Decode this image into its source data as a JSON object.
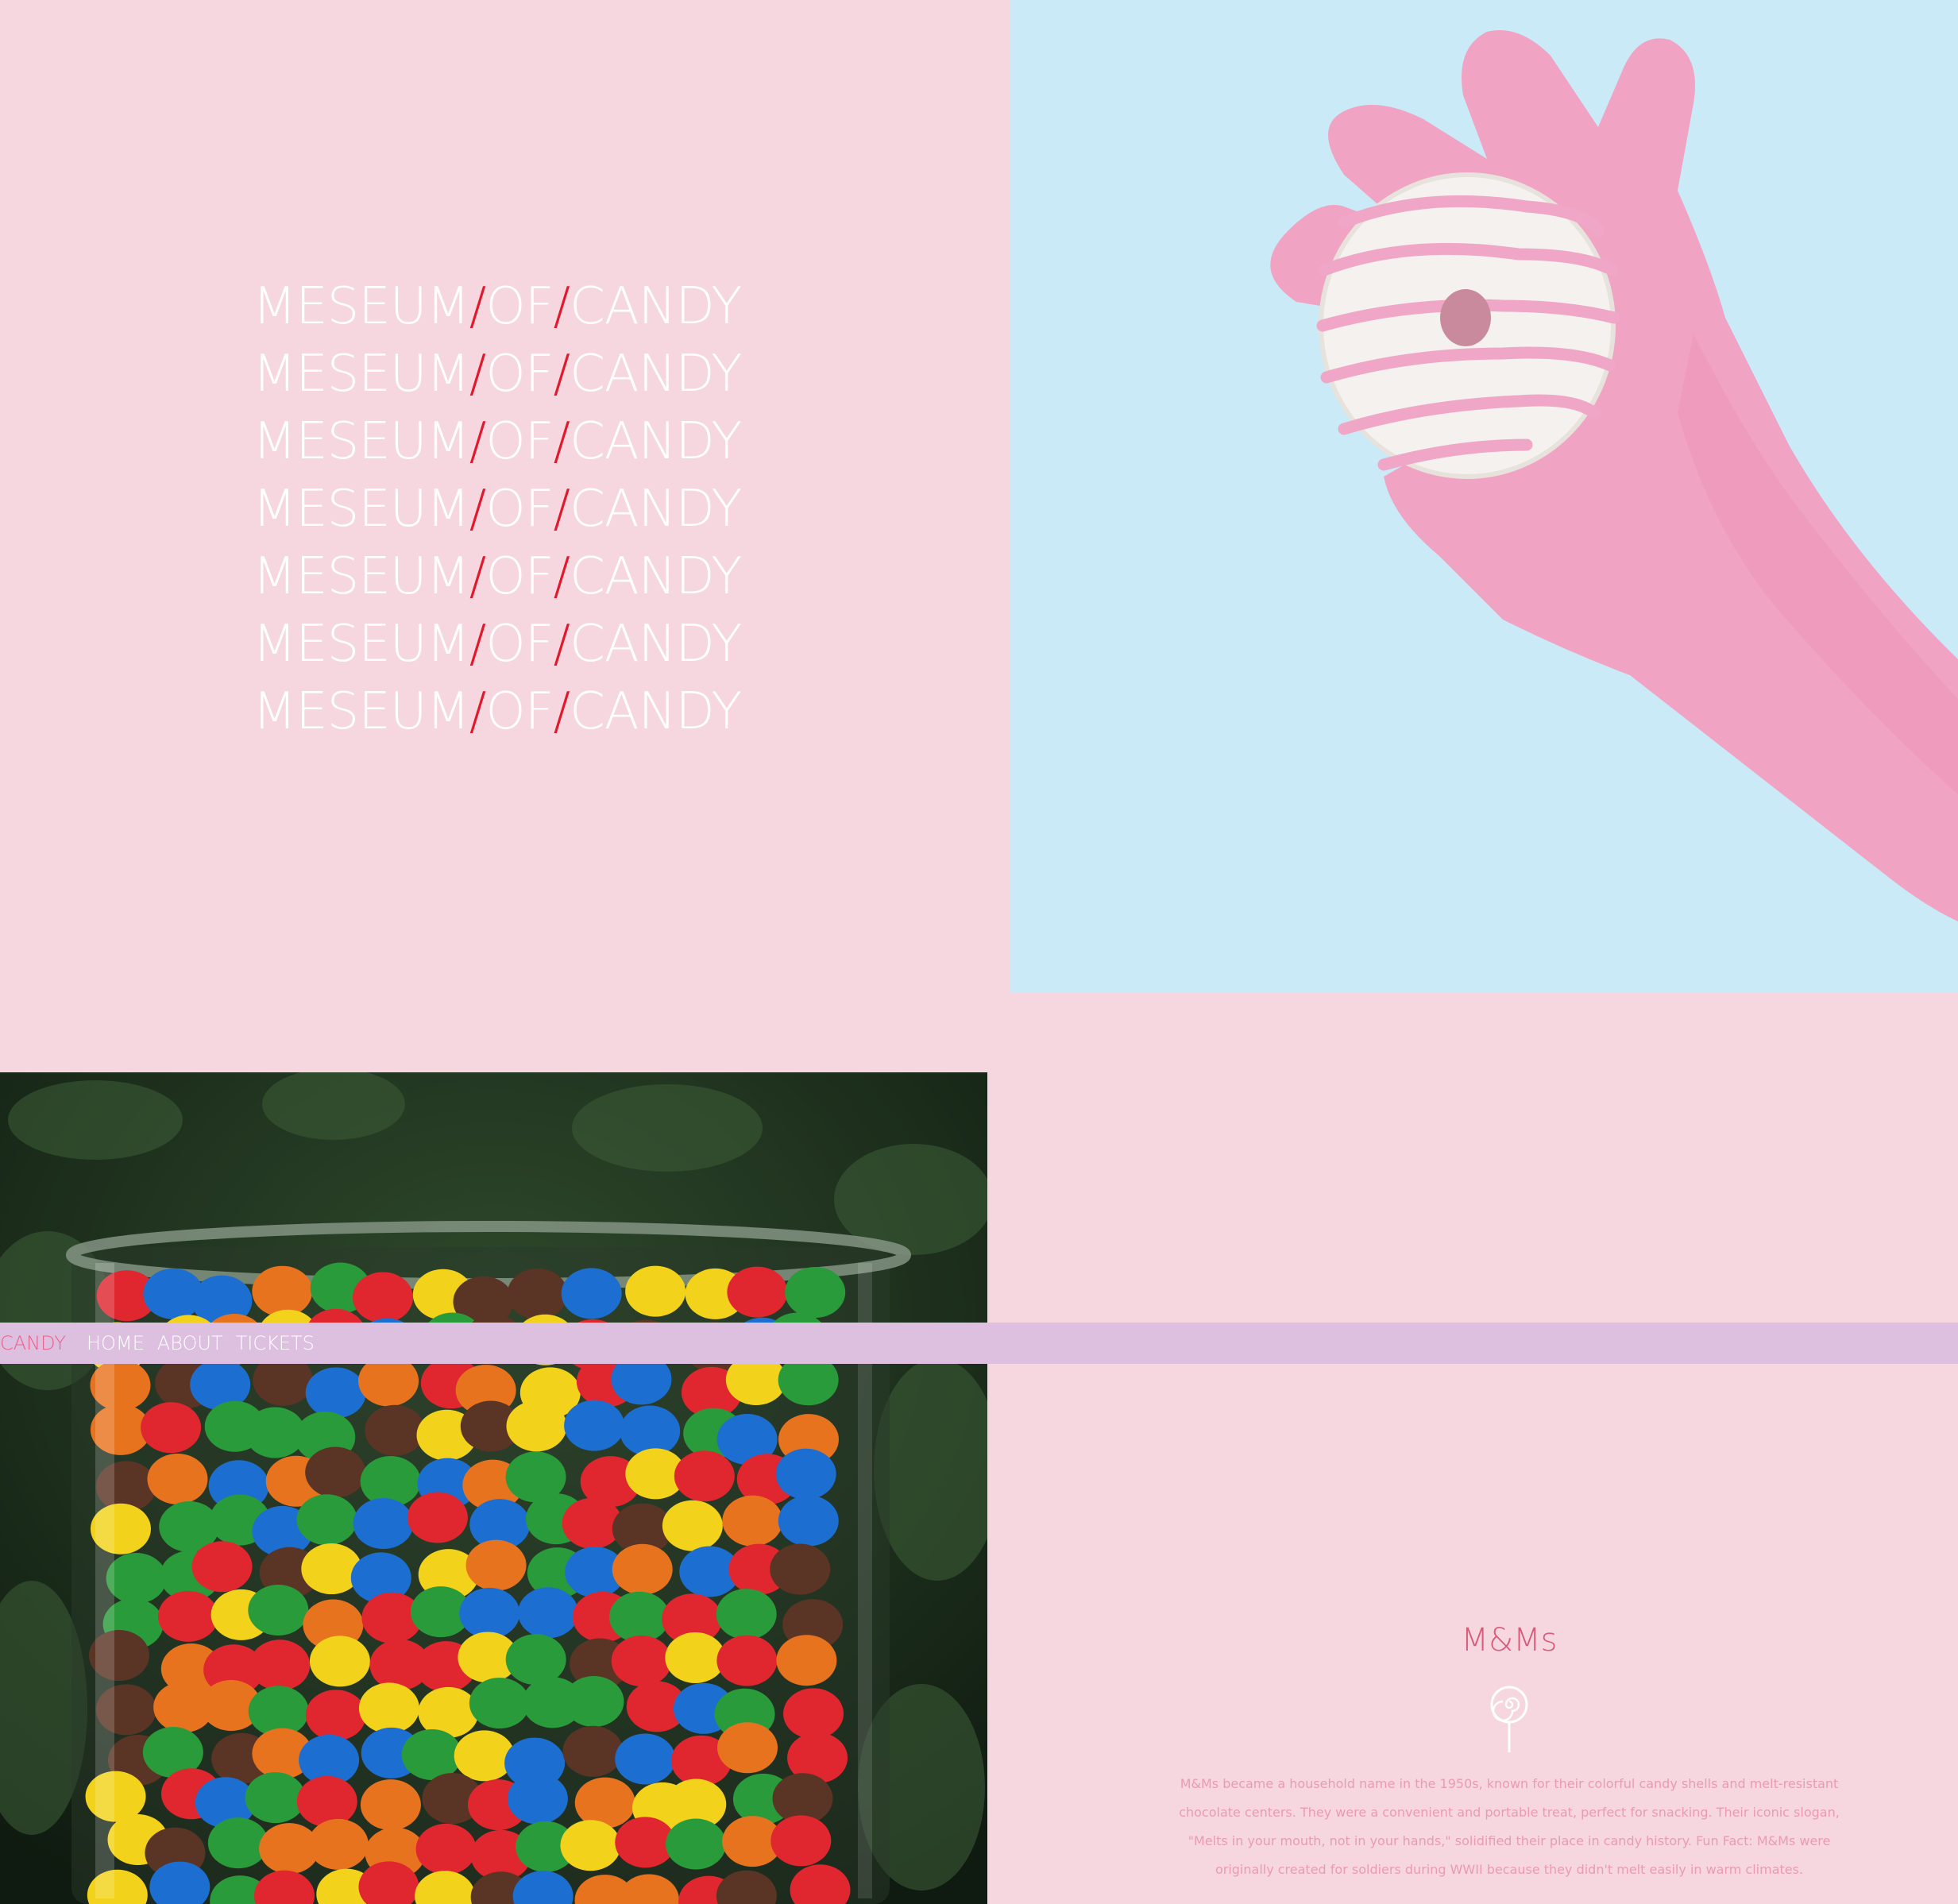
{
  "hero": {
    "lines": [
      {
        "a": "MESEUM",
        "s1": "/",
        "b": "OF",
        "s2": "/",
        "c": "CANDY"
      },
      {
        "a": "MESEUM",
        "s1": "/",
        "b": "OF",
        "s2": "/",
        "c": "CANDY"
      },
      {
        "a": "MESEUM",
        "s1": "/",
        "b": "OF",
        "s2": "/",
        "c": "CANDY"
      },
      {
        "a": "MESEUM",
        "s1": "/",
        "b": "OF",
        "s2": "/",
        "c": "CANDY"
      },
      {
        "a": "MESEUM",
        "s1": "/",
        "b": "OF",
        "s2": "/",
        "c": "CANDY"
      },
      {
        "a": "MESEUM",
        "s1": "/",
        "b": "OF",
        "s2": "/",
        "c": "CANDY"
      },
      {
        "a": "MESEUM",
        "s1": "/",
        "b": "OF",
        "s2": "/",
        "c": "CANDY"
      }
    ]
  },
  "nav": {
    "brand": "CANDY",
    "links": [
      "HOME",
      "ABOUT",
      "TICKETS"
    ]
  },
  "info": {
    "title": "M&Ms",
    "icon": "lollipop-icon",
    "body": "M&Ms became a household name in the 1950s, known for their colorful candy shells and melt-resistant chocolate centers. They were a convenient and portable treat, perfect for snacking. Their iconic slogan, \"Melts in your mouth, not in your hands,\" solidified their place in candy history. Fun Fact: M&Ms were originally created for soldiers during WWII because they didn't melt easily in warm climates."
  },
  "colors": {
    "background": "#f6d7df",
    "accent_slash": "#e2182c",
    "panel_blue": "#c9eaf6",
    "nav_bar": "#ddbfdf",
    "nav_brand": "#e8628a",
    "info_title": "#d95a78"
  }
}
